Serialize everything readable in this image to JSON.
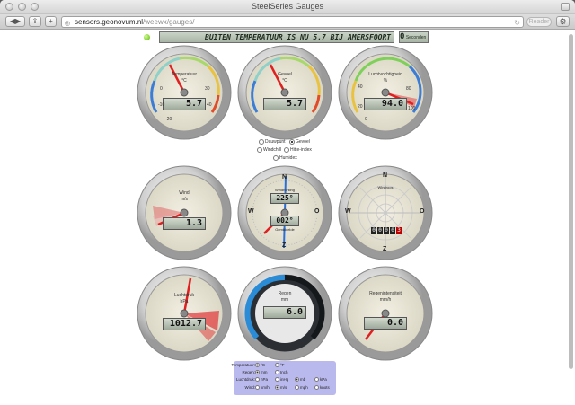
{
  "window": {
    "title": "SteelSeries Gauges"
  },
  "toolbar": {
    "reader": "Reader",
    "url_domain": "sensors.geonovum.nl",
    "url_path": "/weewx/gauges/"
  },
  "header": {
    "marquee": "BUITEN TEMPERATUUR IS NU 5.7 BIJ AMERSFOORT CS",
    "timer_value": "0",
    "timer_label": "Seconden"
  },
  "gauges": {
    "temp": {
      "title": "Temperatuur",
      "unit": "°C",
      "value": "5.7",
      "ticks": [
        "-10",
        "0",
        "10",
        "20",
        "30",
        "40",
        "-20"
      ]
    },
    "dew": {
      "title": "Gevoel",
      "unit": "°C",
      "value": "5.7"
    },
    "hum": {
      "title": "Luchtvochtigheid",
      "unit": "%",
      "value": "94.0",
      "ticks": [
        "20",
        "40",
        "60",
        "80",
        "100",
        "0"
      ]
    },
    "wind": {
      "title": "Wind",
      "unit": "m/s",
      "value": "1.3"
    },
    "dir": {
      "title": "Windrichting",
      "subtitle": "Gemiddelde",
      "value1": "225°",
      "value2": "002°",
      "n": "N",
      "e": "O",
      "s": "Z",
      "w": "W"
    },
    "rose": {
      "title": "Windroos",
      "n": "N",
      "e": "O",
      "s": "Z",
      "w": "W",
      "odo": [
        "0",
        "0",
        "0",
        "0",
        "3"
      ]
    },
    "baro": {
      "title": "Luchtdruk",
      "unit": "hPa",
      "value": "1012.7"
    },
    "rain": {
      "title": "Regen",
      "unit": "mm",
      "value": "6.0"
    },
    "rainrate": {
      "title": "Regenintensiteit",
      "unit": "mm/h",
      "value": "0.0"
    }
  },
  "selectors": {
    "dew_options": [
      "Dauwpunt",
      "Gevoel",
      "Windchill",
      "Hitte-index",
      "Humidex"
    ],
    "selected": "Gevoel"
  },
  "units": {
    "rows": [
      {
        "label": "Temperatuur:",
        "options": [
          "°C",
          "°F"
        ],
        "selected": 0
      },
      {
        "label": "Regen:",
        "options": [
          "mm",
          "Inch"
        ],
        "selected": 0
      },
      {
        "label": "Luchtdruk:",
        "options": [
          "hPa",
          "inHg",
          "mb",
          "kPa"
        ],
        "selected": 2
      },
      {
        "label": "Wind:",
        "options": [
          "km/h",
          "m/s",
          "mph",
          "knots"
        ],
        "selected": 1
      }
    ]
  },
  "colors": {
    "needle": "#e02020",
    "accent_blue": "#2a8bd6",
    "bezel": "#c8c8c8",
    "lcd": "#b9c4b6"
  }
}
